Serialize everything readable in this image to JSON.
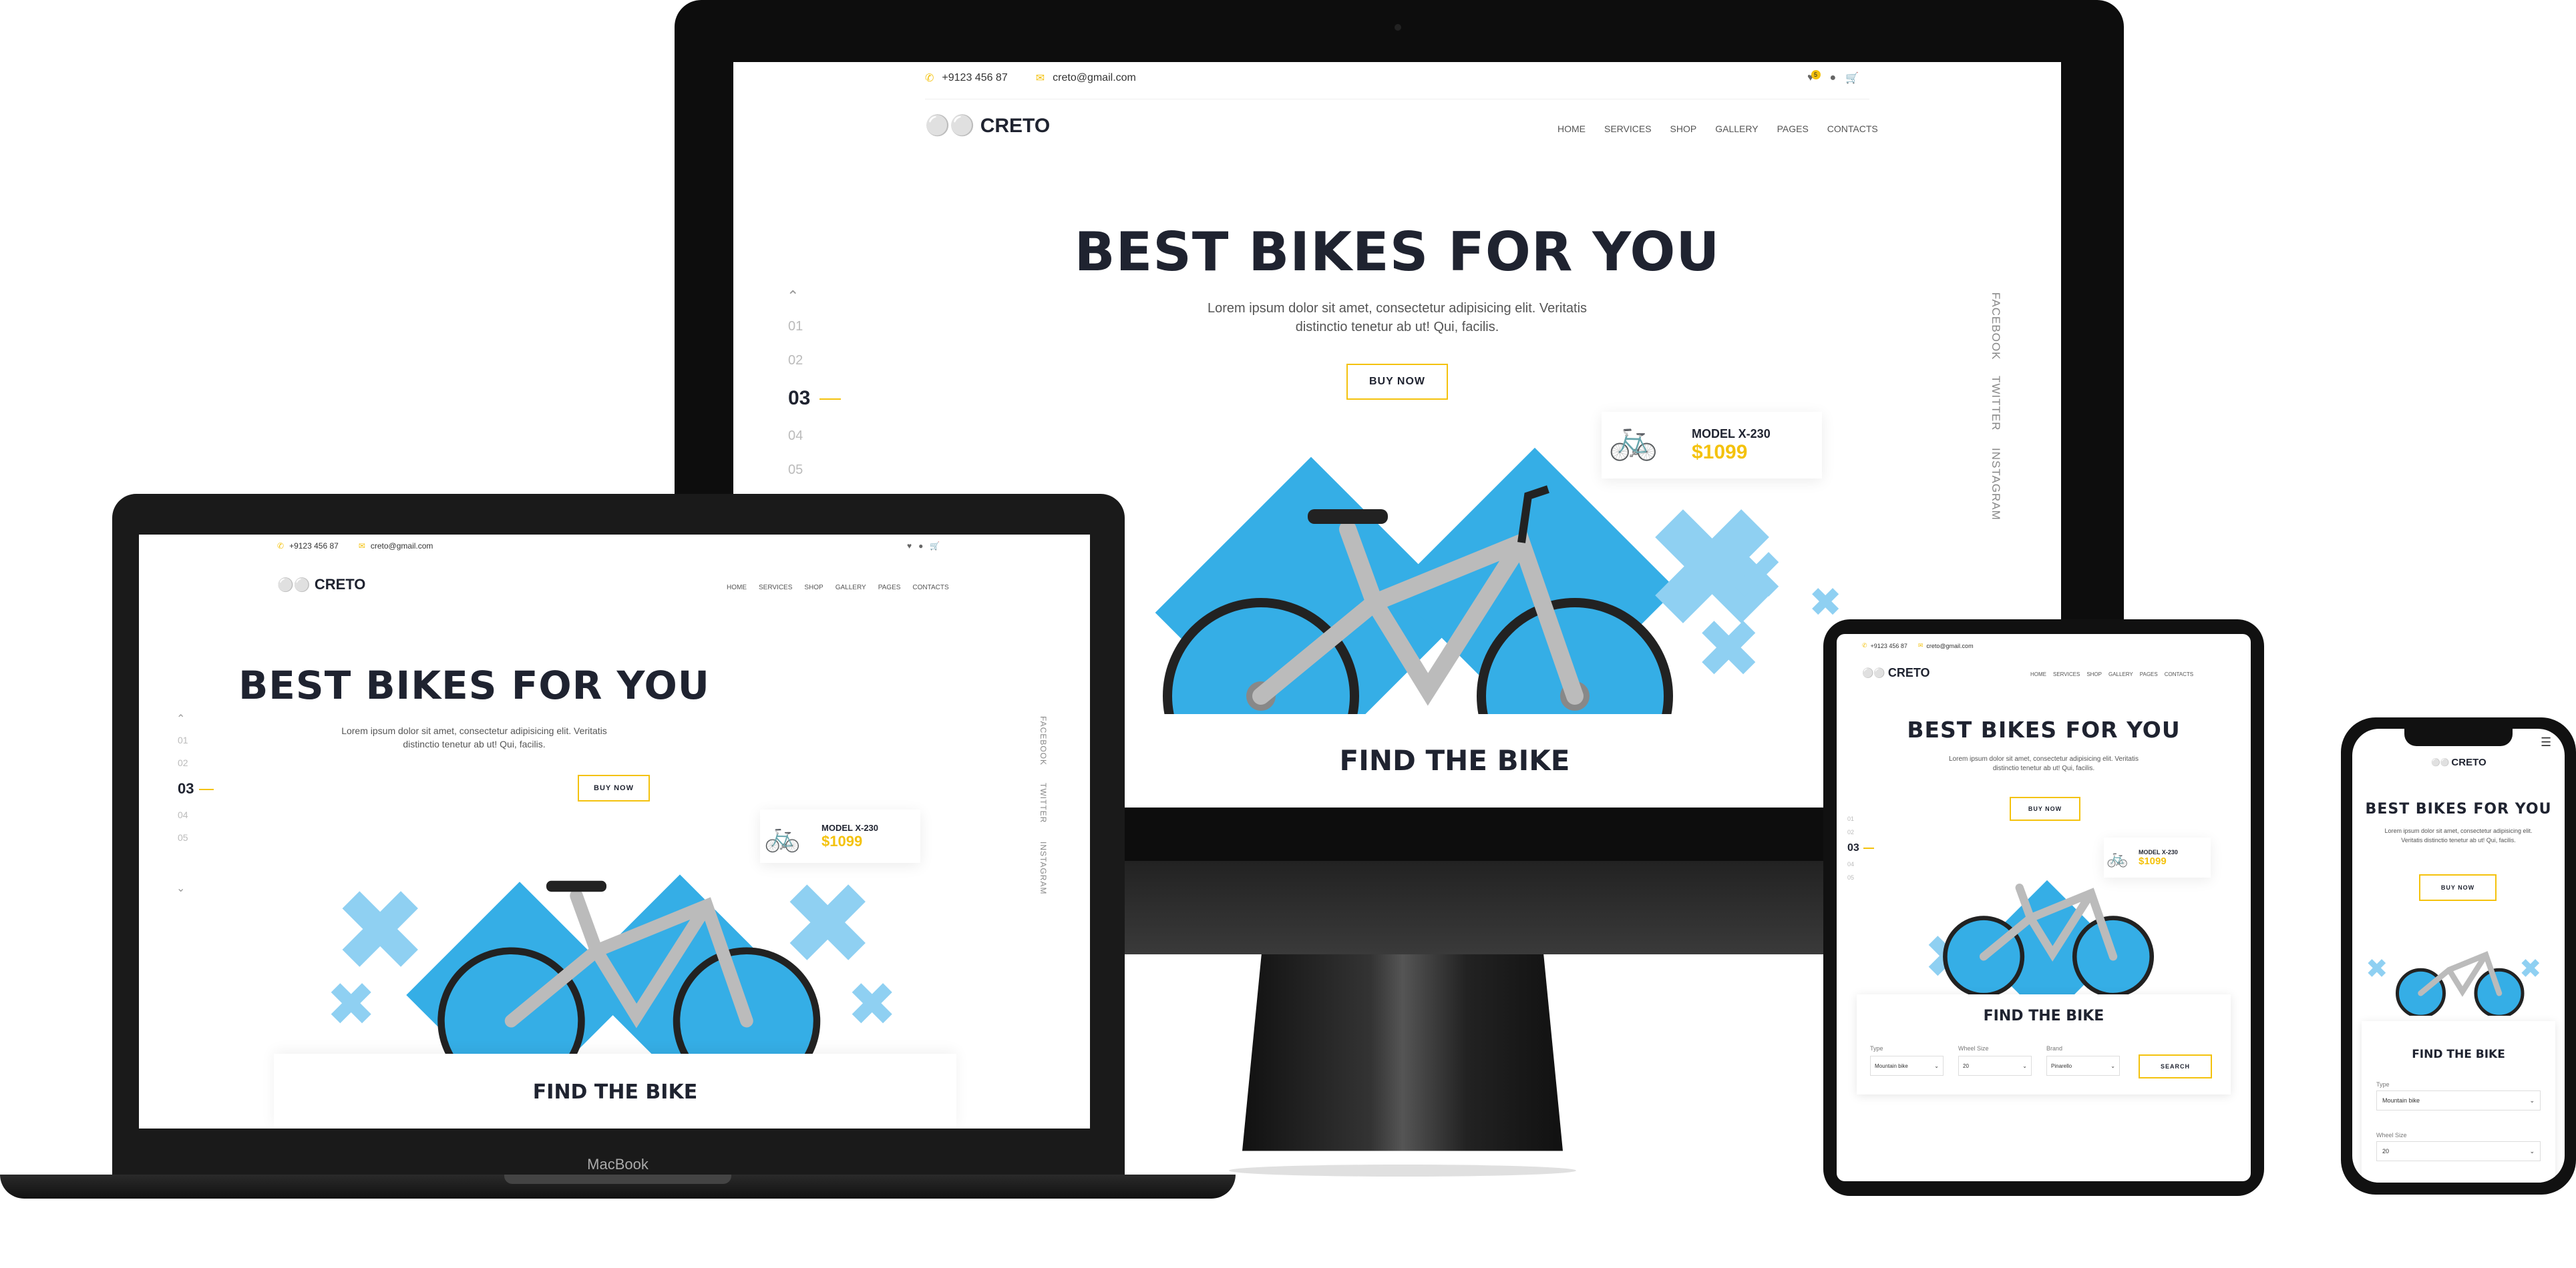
{
  "site": {
    "phone": "+9123 456 87",
    "email": "creto@gmail.com",
    "cart_badge": "5",
    "logo_text": "CRETO",
    "nav": [
      "HOME",
      "SERVICES",
      "SHOP",
      "GALLERY",
      "PAGES",
      "CONTACTS"
    ],
    "hero_title": "BEST BIKES FOR YOU",
    "hero_text_line1": "Lorem ipsum dolor sit amet, consectetur adipisicing elit. Veritatis",
    "hero_text_line2": "distinctio tenetur ab ut! Qui, facilis.",
    "mobile_text_line1": "Lorem ipsum dolor sit amet, consectetur adipisicing elit.",
    "mobile_text_line2": "Veritatis distinctio tenetur ab ut! Qui, facilis.",
    "buy_now": "BUY NOW",
    "slides": [
      "01",
      "02",
      "03",
      "04",
      "05"
    ],
    "current_slide": "03",
    "social": [
      "FACEBOOK",
      "TWITTER",
      "INSTAGRAM"
    ],
    "model_name": "MODEL X-230",
    "model_price": "$1099",
    "find_title": "FIND THE BIKE",
    "filters": {
      "type_label": "Type",
      "type_value": "Mountain bike",
      "wheel_label": "Wheel Size",
      "wheel_value": "20",
      "brand_label": "Brand",
      "brand_value": "Pinarello",
      "search_label": "SEARCH"
    }
  },
  "devices": {
    "laptop_label": "MacBook"
  },
  "colors": {
    "accent": "#f4c20d",
    "blue": "#35aee6",
    "light_blue": "#8fd0f2",
    "dark": "#1f2330",
    "frame": "#111111"
  }
}
